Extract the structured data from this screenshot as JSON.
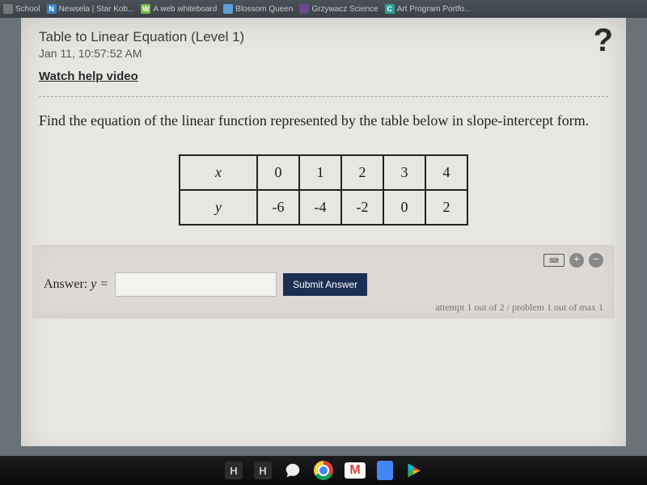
{
  "tabs": [
    {
      "label": "School",
      "favicon_bg": "#777",
      "favicon_text": ""
    },
    {
      "label": "Newsela | Star Kob...",
      "favicon_bg": "#3b7fc4",
      "favicon_text": "N"
    },
    {
      "label": "A web whiteboard",
      "favicon_bg": "#7ab84a",
      "favicon_text": "W"
    },
    {
      "label": "Blossom Queen",
      "favicon_bg": "#5aa0d8",
      "favicon_text": ""
    },
    {
      "label": "Grzywacz Science",
      "favicon_bg": "#6a4a8a",
      "favicon_text": ""
    },
    {
      "label": "Art Program Portfo...",
      "favicon_bg": "#2aa198",
      "favicon_text": "C"
    }
  ],
  "card": {
    "title": "Table to Linear Equation (Level 1)",
    "timestamp": "Jan 11, 10:57:52 AM",
    "help_link": "Watch help video",
    "help_icon": "?",
    "prompt": "Find the equation of the linear function represented by the table below in slope-intercept form.",
    "table": {
      "row_x_label": "x",
      "row_y_label": "y",
      "x": [
        "0",
        "1",
        "2",
        "3",
        "4"
      ],
      "y": [
        "-6",
        "-4",
        "-2",
        "0",
        "2"
      ]
    },
    "answer": {
      "label_prefix": "Answer: ",
      "label_var": "y =",
      "input_value": "",
      "submit_label": "Submit Answer",
      "attempt_text": "attempt 1 out of 2 / problem 1 out of max 1"
    }
  },
  "taskbar": {
    "icons": [
      "H",
      "H",
      "chat",
      "chrome",
      "gmail",
      "docs",
      "play"
    ]
  }
}
